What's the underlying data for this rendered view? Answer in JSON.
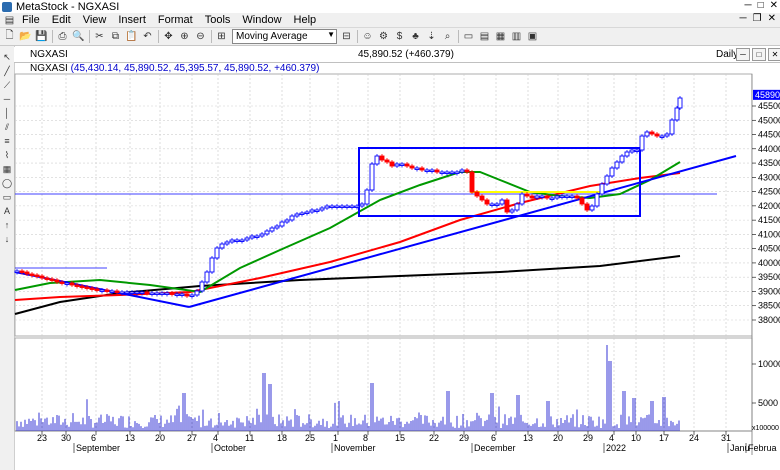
{
  "window": {
    "title": "MetaStock - NGXASI"
  },
  "menu": [
    "File",
    "Edit",
    "View",
    "Insert",
    "Format",
    "Tools",
    "Window",
    "Help"
  ],
  "toolbar": {
    "indicator_select": "Moving Average"
  },
  "document": {
    "name": "NGXASI",
    "price_change": "45,890.52 (+460.379)",
    "period": "Daily"
  },
  "info": {
    "symbol": "NGXASI",
    "ohlc": "(45,430.14, 45,890.52, 45,395.57, 45,890.52, +460.379)"
  },
  "price_axis": {
    "labels": [
      "45500",
      "45000",
      "44500",
      "44000",
      "43500",
      "43000",
      "42500",
      "42000",
      "41500",
      "41000",
      "40500",
      "40000",
      "39500",
      "39000",
      "38500",
      "38000"
    ],
    "current_label": "45890.5"
  },
  "volume_axis": {
    "labels": [
      "10000",
      "5000"
    ],
    "unit": "x100000"
  },
  "date_axis": {
    "days": [
      "23",
      "30",
      "6",
      "13",
      "20",
      "27",
      "4",
      "11",
      "18",
      "25",
      "1",
      "8",
      "15",
      "22",
      "29",
      "6",
      "13",
      "20",
      "29",
      "4",
      "10",
      "17",
      "24",
      "31"
    ],
    "months": [
      "September",
      "October",
      "November",
      "December",
      "2022",
      "Janu",
      "Februa"
    ]
  },
  "colors": {
    "up": "#0000ff",
    "down": "#ff0000",
    "ma_short": "#009900",
    "ma_mid": "#ff0000",
    "ma_long": "#000000",
    "trend": "#0000ff",
    "box": "#0000ff",
    "support": "#ffff00"
  },
  "icons": {
    "file_new": "file-icon",
    "open": "folder-icon",
    "save": "save-icon",
    "print": "print-icon"
  }
}
